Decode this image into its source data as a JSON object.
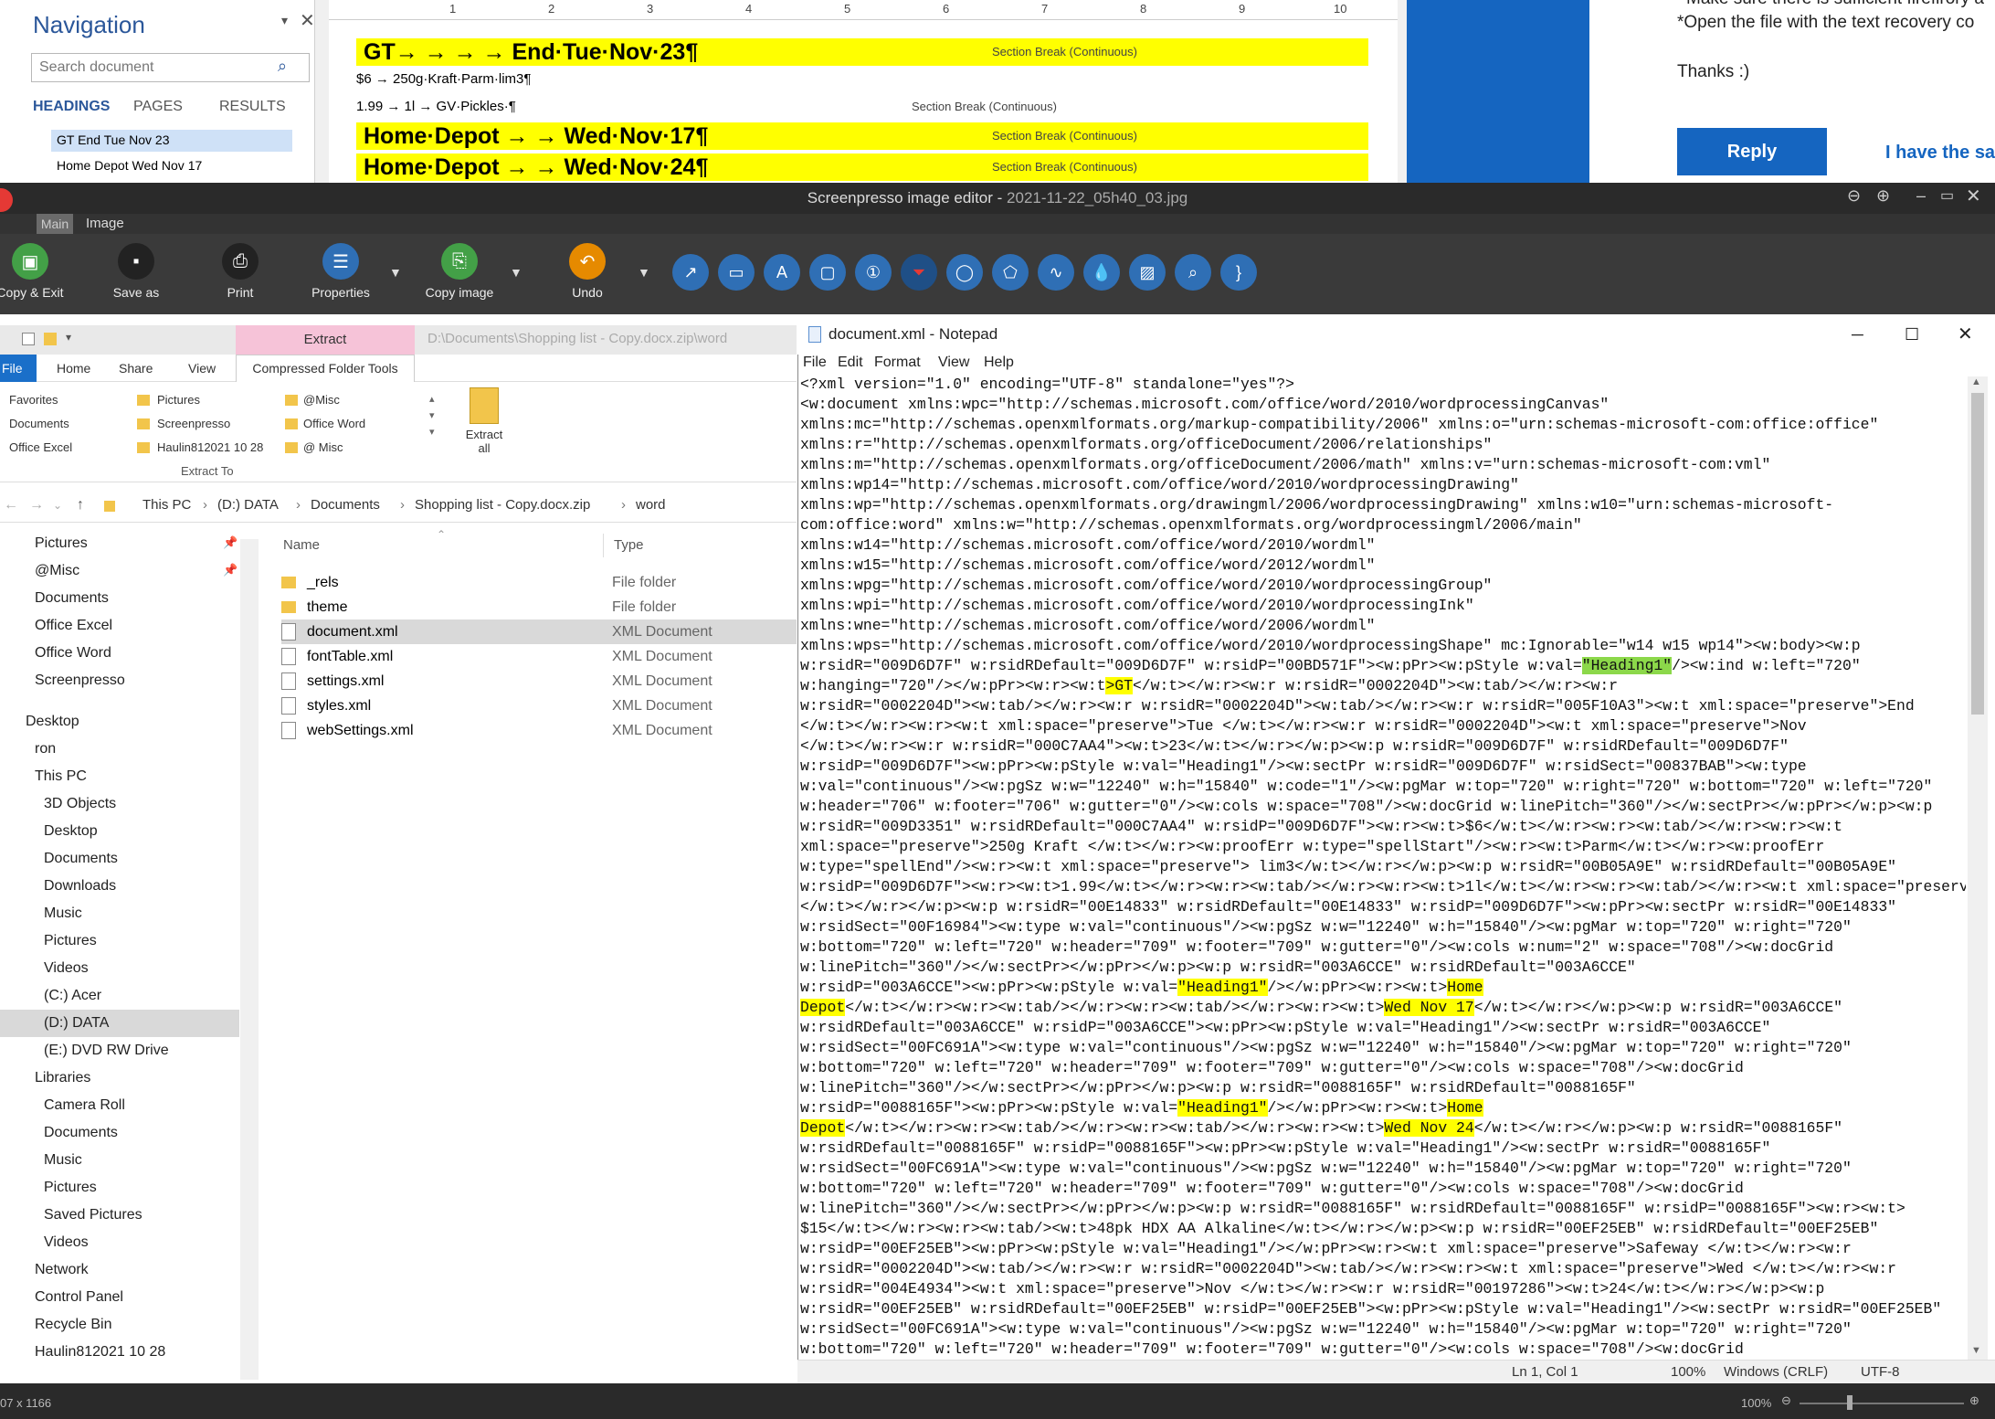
{
  "word": {
    "nav_title": "Navigation",
    "search_placeholder": "Search document",
    "tabs": [
      "HEADINGS",
      "PAGES",
      "RESULTS"
    ],
    "headings": [
      "GT   End Tue Nov 23",
      "Home Depot  Wed Nov 17"
    ],
    "ruler_marks": [
      "1",
      "2",
      "3",
      "4",
      "5",
      "6",
      "7",
      "8",
      "9",
      "10"
    ],
    "doc_lines": {
      "l1": "GT→  →  →  →  End·Tue·Nov·23¶",
      "l2": "$6  →  250g·Kraft·Parm·lim3¶",
      "l3": "1.99 →  1l  →  GV·Pickles·¶",
      "l4": "Home·Depot  →  →  Wed·Nov·17¶",
      "l5": "Home·Depot  →  →  Wed·Nov·24¶",
      "section_break": "Section Break (Continuous)"
    },
    "reply_text_1": "*Open the file with the text recovery co",
    "reply_text_0": "Make sure there is sufficient firefirory a",
    "thanks": "Thanks :)",
    "reply_button": "Reply",
    "same_link": "I have the sa"
  },
  "screenpresso": {
    "title": "Screenpresso image editor  -  ",
    "filename": "2021-11-22_05h40_03.jpg",
    "tabs": [
      "Main",
      "Image"
    ],
    "buttons": {
      "copy_exit": "Copy & Exit",
      "save_as": "Save as",
      "print": "Print",
      "properties": "Properties",
      "copy_image": "Copy image",
      "undo": "Undo"
    }
  },
  "explorer": {
    "context_tab": "Extract",
    "path_ghost": "D:\\Documents\\Shopping list - Copy.docx.zip\\word",
    "tabs": [
      "File",
      "Home",
      "Share",
      "View",
      "Compressed Folder Tools"
    ],
    "ribbon_items": [
      "Favorites",
      "Pictures",
      "@Misc",
      "Documents",
      "Screenpresso",
      "Office Word",
      "Office Excel",
      "Haulin812021 10 28",
      "@ Misc"
    ],
    "extract_all": "Extract all",
    "extract_to": "Extract To",
    "breadcrumb": [
      "This PC",
      "(D:) DATA",
      "Documents",
      "Shopping list - Copy.docx.zip",
      "word"
    ],
    "tree": [
      "Pictures",
      "@Misc",
      "Documents",
      "Office Excel",
      "Office Word",
      "Screenpresso",
      "Desktop",
      "ron",
      "This PC",
      "3D Objects",
      "Desktop",
      "Documents",
      "Downloads",
      "Music",
      "Pictures",
      "Videos",
      "(C:) Acer",
      "(D:) DATA",
      "(E:) DVD RW Drive",
      "Libraries",
      "Camera Roll",
      "Documents",
      "Music",
      "Pictures",
      "Saved Pictures",
      "Videos",
      "Network",
      "Control Panel",
      "Recycle Bin",
      "Haulin812021 10 28"
    ],
    "columns": [
      "Name",
      "Type"
    ],
    "files": [
      {
        "name": "_rels",
        "type": "File folder"
      },
      {
        "name": "theme",
        "type": "File folder"
      },
      {
        "name": "document.xml",
        "type": "XML Document"
      },
      {
        "name": "fontTable.xml",
        "type": "XML Document"
      },
      {
        "name": "settings.xml",
        "type": "XML Document"
      },
      {
        "name": "styles.xml",
        "type": "XML Document"
      },
      {
        "name": "webSettings.xml",
        "type": "XML Document"
      }
    ]
  },
  "notepad": {
    "title": "document.xml - Notepad",
    "menu": [
      "File",
      "Edit",
      "Format",
      "View",
      "Help"
    ],
    "status_pos": "Ln 1, Col 1",
    "status_zoom": "100%",
    "status_eol": "Windows (CRLF)",
    "status_enc": "UTF-8"
  },
  "bottom": {
    "dims": "07 x 1166",
    "zoom": "100%"
  }
}
